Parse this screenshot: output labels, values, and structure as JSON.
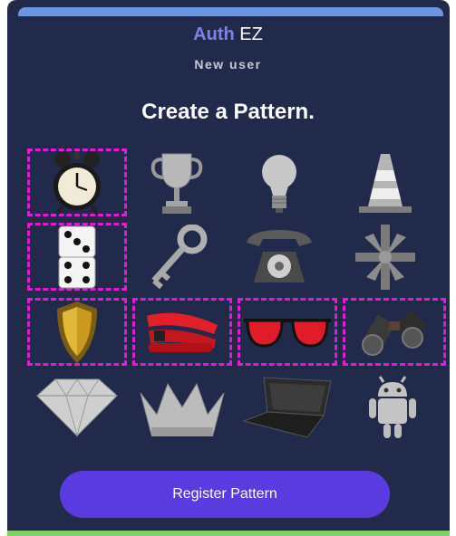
{
  "brand": {
    "part1": "Auth",
    "part2": "EZ"
  },
  "subtitle": "New user",
  "heading": "Create a Pattern.",
  "pattern_items": [
    {
      "name": "alarm-clock",
      "selected": true
    },
    {
      "name": "trophy",
      "selected": false
    },
    {
      "name": "light-bulb",
      "selected": false
    },
    {
      "name": "traffic-cone",
      "selected": false
    },
    {
      "name": "dice",
      "selected": true
    },
    {
      "name": "key",
      "selected": false
    },
    {
      "name": "telephone",
      "selected": false
    },
    {
      "name": "gift-bow",
      "selected": false
    },
    {
      "name": "shield",
      "selected": true
    },
    {
      "name": "stapler",
      "selected": true
    },
    {
      "name": "sunglasses",
      "selected": true
    },
    {
      "name": "binoculars",
      "selected": true
    },
    {
      "name": "diamond",
      "selected": false
    },
    {
      "name": "crown",
      "selected": false
    },
    {
      "name": "laptop",
      "selected": false
    },
    {
      "name": "android-robot",
      "selected": false
    }
  ],
  "register_button": "Register Pattern",
  "colors": {
    "background": "#212a4b",
    "accent": "#5a3be0",
    "brand_accent": "#7d82e8",
    "selection": "#e11bd6",
    "top_bar": "#6b95e3",
    "bottom_bar": "#7cd16b"
  }
}
